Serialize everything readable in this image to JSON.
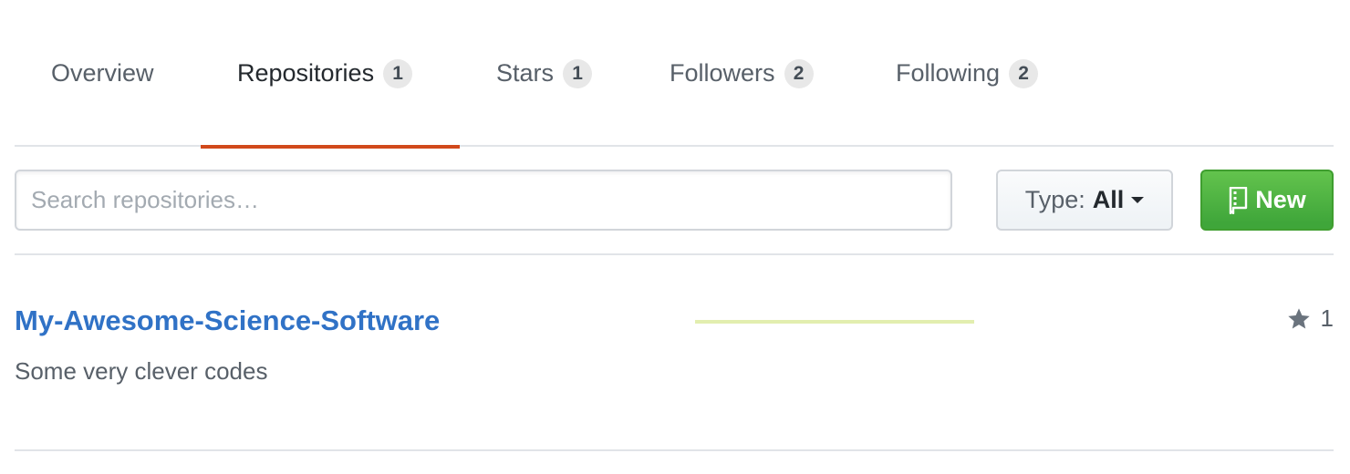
{
  "tabs": [
    {
      "label": "Overview",
      "count": null,
      "selected": false
    },
    {
      "label": "Repositories",
      "count": "1",
      "selected": true
    },
    {
      "label": "Stars",
      "count": "1",
      "selected": false
    },
    {
      "label": "Followers",
      "count": "2",
      "selected": false
    },
    {
      "label": "Following",
      "count": "2",
      "selected": false
    }
  ],
  "filter": {
    "search_placeholder": "Search repositories…",
    "search_value": "",
    "type_prefix": "Type:",
    "type_value": "All",
    "new_label": "New"
  },
  "repositories": [
    {
      "name": "My-Awesome-Science-Software",
      "description": "Some very clever codes",
      "stars": "1"
    }
  ],
  "colors": {
    "selected_tab_underline": "#d1491b",
    "link": "#3072c6",
    "new_button": "#4bb543",
    "activity_graph": "#e2eeaf"
  },
  "icons": {
    "new_button_icon": "repo-icon",
    "stars_icon": "star-icon",
    "type_dropdown": "caret-down-icon"
  }
}
